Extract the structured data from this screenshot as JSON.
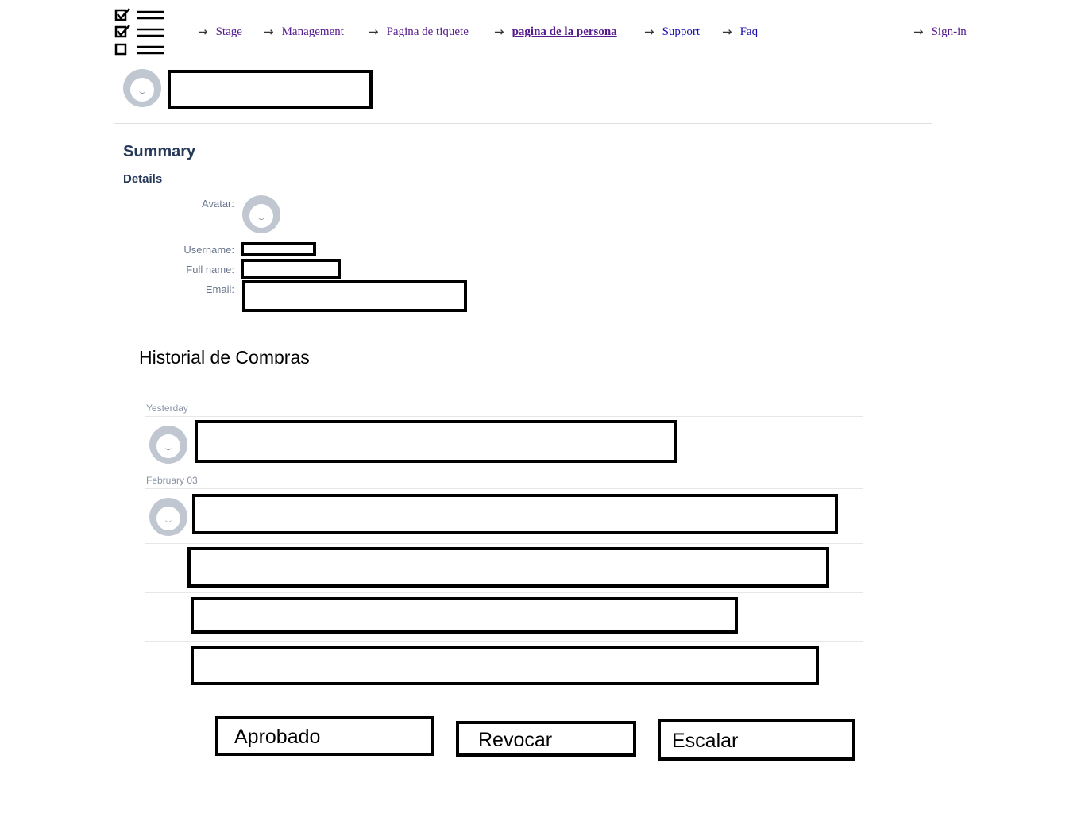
{
  "nav": {
    "items": [
      {
        "label": "Stage",
        "style": "visited"
      },
      {
        "label": "Management",
        "style": "visited"
      },
      {
        "label": "Pagina de tiquete",
        "style": "visited"
      },
      {
        "label": "pagina de la persona",
        "style": "active"
      },
      {
        "label": "Support",
        "style": "plain"
      },
      {
        "label": "Faq",
        "style": "plain"
      }
    ],
    "signin": "Sign-in",
    "arrow": "→"
  },
  "summary": {
    "title": "Summary",
    "details_title": "Details",
    "labels": {
      "avatar": "Avatar:",
      "username": "Username:",
      "fullname": "Full name:",
      "email": "Email:"
    }
  },
  "history": {
    "title": "Historial de Compras",
    "groups": [
      {
        "date": "Yesterday"
      },
      {
        "date": "February 03"
      }
    ]
  },
  "actions": {
    "approve": "Aprobado",
    "revoke": "Revocar",
    "escalate": "Escalar"
  },
  "colors": {
    "link_visited": "#551a8b",
    "link_plain": "#1a0dab",
    "heading": "#253858",
    "avatar_bg": "#c1c7d0"
  },
  "icons": {
    "logo": "checklist-icon",
    "nav_arrow": "arrow-right-icon",
    "avatar": "default-avatar-icon"
  }
}
